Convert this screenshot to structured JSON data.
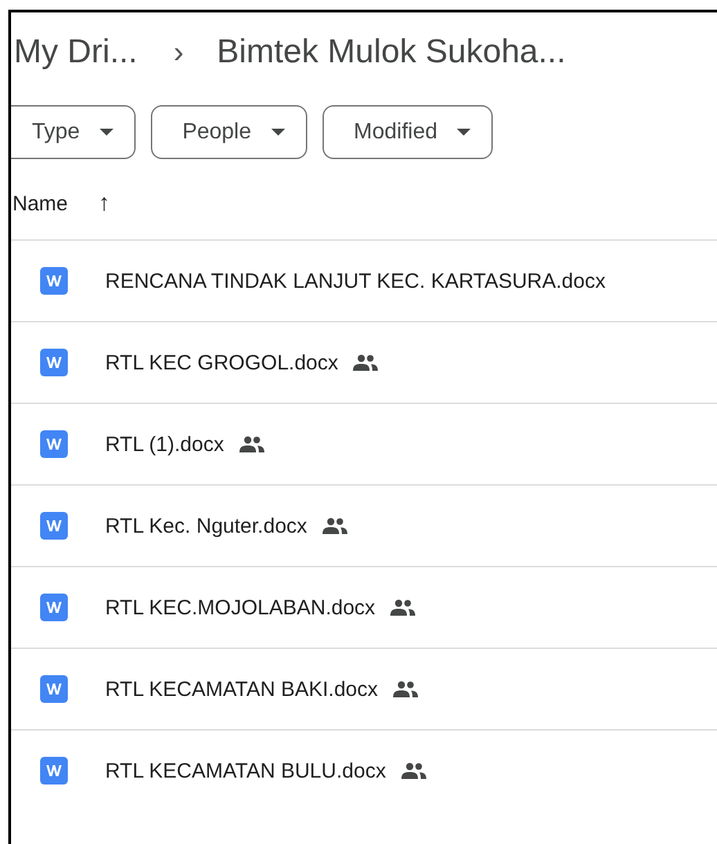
{
  "breadcrumb": [
    {
      "label": "My Dri..."
    },
    {
      "label": "Bimtek Mulok Sukoha..."
    }
  ],
  "breadcrumb_separator": "›",
  "filters": [
    {
      "label": "Type"
    },
    {
      "label": "People"
    },
    {
      "label": "Modified"
    }
  ],
  "table": {
    "sort_column": "Name",
    "sort_arrow": "↑",
    "rows": [
      {
        "name": "RENCANA TINDAK LANJUT KEC. KARTASURA.docx",
        "kind": "word",
        "shared": false
      },
      {
        "name": "RTL  KEC GROGOL.docx",
        "kind": "word",
        "shared": true
      },
      {
        "name": "RTL (1).docx",
        "kind": "word",
        "shared": true
      },
      {
        "name": "RTL Kec. Nguter.docx",
        "kind": "word",
        "shared": true
      },
      {
        "name": "RTL KEC.MOJOLABAN.docx",
        "kind": "word",
        "shared": true
      },
      {
        "name": "RTL KECAMATAN BAKI.docx",
        "kind": "word",
        "shared": true
      },
      {
        "name": "RTL KECAMATAN BULU.docx",
        "kind": "word",
        "shared": true
      }
    ]
  }
}
